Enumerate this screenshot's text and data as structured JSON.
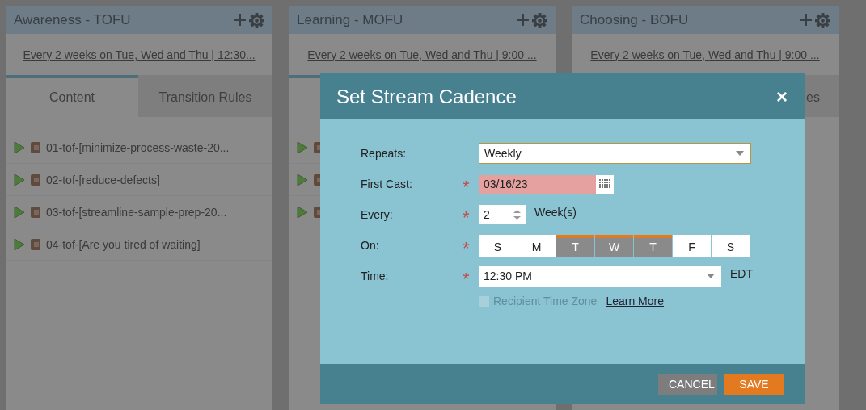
{
  "columns": [
    {
      "title": "Awareness - TOFU",
      "cadence": "Every 2 weeks on Tue, Wed and Thu | 12:30...",
      "tabs": [
        {
          "label": "Content",
          "selected": true
        },
        {
          "label": "Transition Rules",
          "selected": false
        }
      ],
      "items": [
        {
          "kind": "labeled",
          "label": "01-tof-[minimize-process-waste-20..."
        },
        {
          "kind": "labeled",
          "label": "02-tof-[reduce-defects]"
        },
        {
          "kind": "labeled",
          "label": "03-tof-[streamline-sample-prep-20..."
        },
        {
          "kind": "labeled",
          "label": "04-tof-[Are you tired of waiting]"
        }
      ]
    },
    {
      "title": "Learning - MOFU",
      "cadence": "Every 2 weeks on Tue, Wed and Thu | 9:00 ...",
      "tabs": [
        {
          "selected": true
        }
      ],
      "items": [
        {
          "kind": "icons-only"
        },
        {
          "kind": "icons-only"
        },
        {
          "kind": "icons-only"
        }
      ]
    },
    {
      "title": "Choosing - BOFU",
      "cadence": "Every 2 weeks on Tue, Wed and Thu | 9:00 ...",
      "tabs": [
        {
          "label": "es",
          "selected": false
        }
      ]
    }
  ],
  "dialog": {
    "title": "Set Stream Cadence",
    "close": "×",
    "repeats": {
      "label": "Repeats:",
      "value": "Weekly"
    },
    "first_cast": {
      "label": "First Cast:",
      "required_mark": "*",
      "value": "03/16/23",
      "invalid": true
    },
    "every": {
      "label": "Every:",
      "required_mark": "*",
      "value": "2",
      "unit": "Week(s)"
    },
    "on": {
      "label": "On:",
      "required_mark": "*",
      "days": [
        {
          "label": "S",
          "selected": false
        },
        {
          "label": "M",
          "selected": false
        },
        {
          "label": "T",
          "selected": true
        },
        {
          "label": "W",
          "selected": true
        },
        {
          "label": "T",
          "selected": true
        },
        {
          "label": "F",
          "selected": false
        },
        {
          "label": "S",
          "selected": false
        }
      ]
    },
    "time": {
      "label": "Time:",
      "required_mark": "*",
      "value": "12:30 PM",
      "zone": "EDT"
    },
    "recipient_time_zone": {
      "label": "Recipient Time Zone",
      "checked": false,
      "disabled": true
    },
    "learn_more": "Learn More",
    "buttons": [
      {
        "label": "CANCEL",
        "kind": "secondary"
      },
      {
        "label": "SAVE",
        "kind": "primary"
      }
    ]
  }
}
